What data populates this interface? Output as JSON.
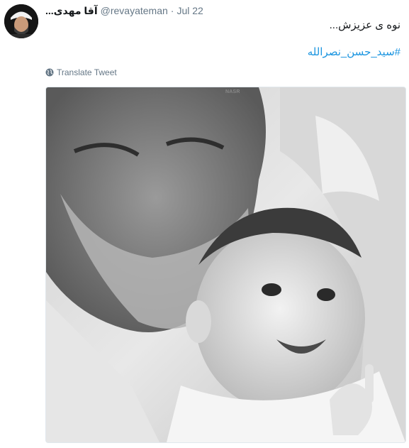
{
  "tweet": {
    "display_name": "...آقا مهدی",
    "handle": "@revayateman",
    "separator": "·",
    "date": "Jul 22",
    "text": "نوه ی عزیزش...",
    "hashtag": "#سید_حسن_نصرالله",
    "translate_label": "Translate Tweet",
    "photo_credit": "NASR"
  },
  "colors": {
    "link": "#1b95e0",
    "secondary_text": "#657786",
    "primary_text": "#14171a"
  },
  "icons": {
    "translate": "globe-icon",
    "avatar": "avatar-image"
  }
}
